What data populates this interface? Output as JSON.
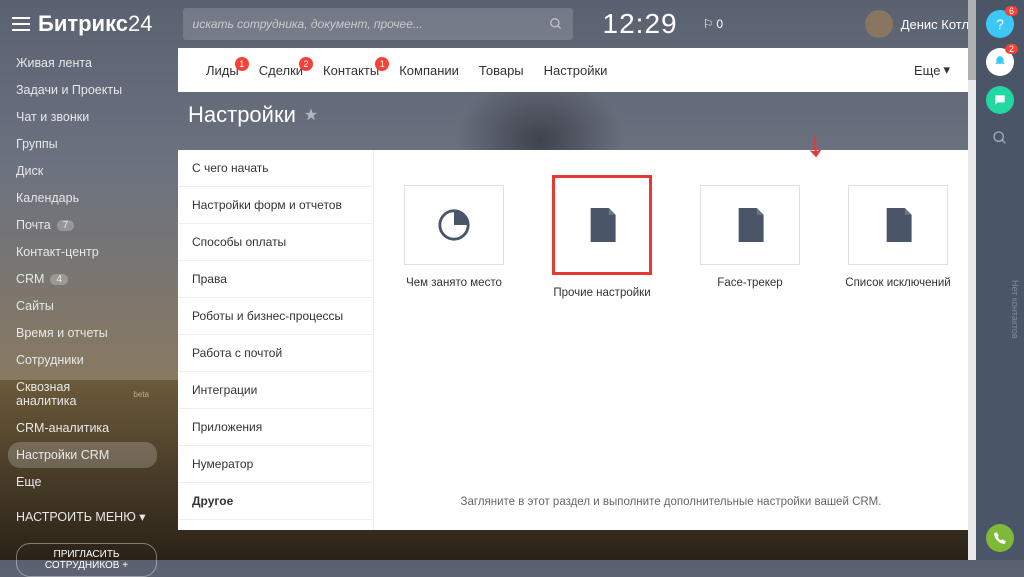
{
  "logo": {
    "part1": "Битрикс",
    "part2": "24"
  },
  "search": {
    "placeholder": "искать сотрудника, документ, прочее..."
  },
  "clock": "12:29",
  "flag_count": "0",
  "user_name": "Денис Котлярчук",
  "left_menu": [
    {
      "label": "Живая лента"
    },
    {
      "label": "Задачи и Проекты"
    },
    {
      "label": "Чат и звонки"
    },
    {
      "label": "Группы"
    },
    {
      "label": "Диск"
    },
    {
      "label": "Календарь"
    },
    {
      "label": "Почта",
      "badge": "7"
    },
    {
      "label": "Контакт-центр"
    },
    {
      "label": "CRM",
      "badge": "4"
    },
    {
      "label": "Сайты"
    },
    {
      "label": "Время и отчеты"
    },
    {
      "label": "Сотрудники"
    },
    {
      "label": "Сквозная аналитика",
      "beta": "beta"
    },
    {
      "label": "CRM-аналитика"
    },
    {
      "label": "Настройки CRM",
      "active": true
    },
    {
      "label": "Еще"
    }
  ],
  "menu_config": "НАСТРОИТЬ МЕНЮ",
  "invite": "ПРИГЛАСИТЬ СОТРУДНИКОВ  +",
  "tabs": [
    {
      "label": "Лиды",
      "dot": "1"
    },
    {
      "label": "Сделки",
      "dot": "2"
    },
    {
      "label": "Контакты",
      "dot": "1"
    },
    {
      "label": "Компании"
    },
    {
      "label": "Товары"
    },
    {
      "label": "Настройки"
    }
  ],
  "tabs_more": "Еще",
  "page_title": "Настройки",
  "side_list": [
    "С чего начать",
    "Настройки форм и отчетов",
    "Способы оплаты",
    "Права",
    "Роботы и бизнес-процессы",
    "Работа с почтой",
    "Интеграции",
    "Приложения",
    "Нумератор",
    "Другое"
  ],
  "side_active_index": 9,
  "cards": [
    {
      "label": "Чем занято место",
      "icon": "pie"
    },
    {
      "label": "Прочие настройки",
      "icon": "doc",
      "highlight": true
    },
    {
      "label": "Face-трекер",
      "icon": "doc"
    },
    {
      "label": "Список исключений",
      "icon": "doc"
    }
  ],
  "description": "Загляните в этот раздел и выполните дополнительные настройки вашей CRM.",
  "rail": {
    "help_badge": "6",
    "bell_badge": "2"
  },
  "vert": "Нет контактов"
}
